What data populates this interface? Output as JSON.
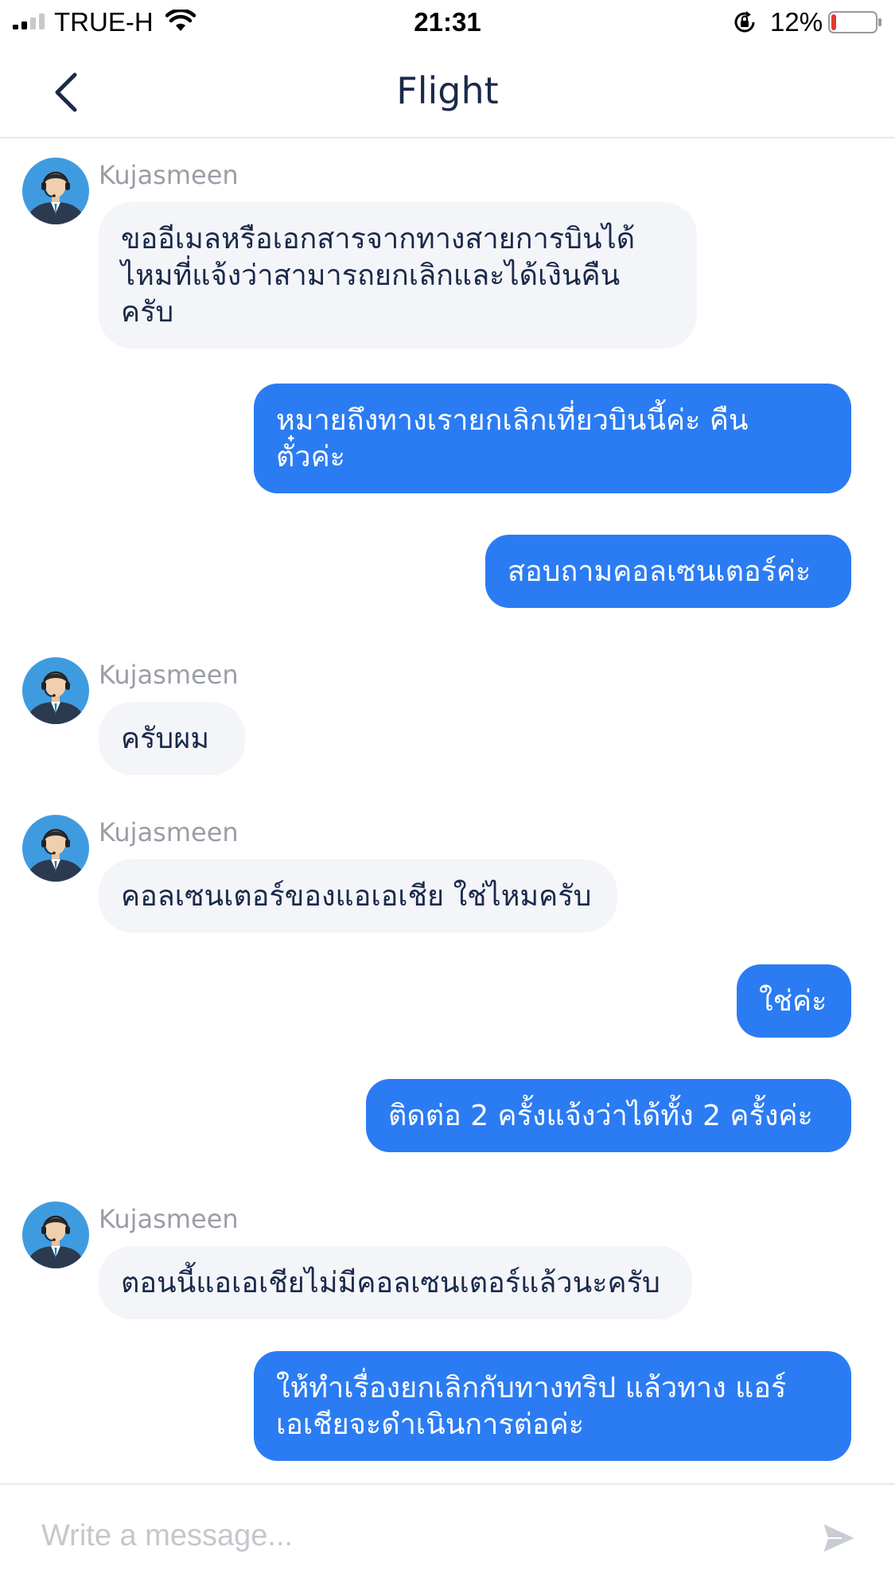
{
  "status_bar": {
    "carrier": "TRUE-H",
    "time": "21:31",
    "battery_percent": "12%",
    "battery_level": 0.12,
    "battery_color": "#e5392f",
    "signal_bars": 2
  },
  "nav": {
    "title": "Flight",
    "back_icon": "chevron-left-icon"
  },
  "chat": {
    "messages": [
      {
        "direction": "incoming",
        "sender": "Kujasmeen",
        "lines": [
          "ขออีเมลหรือเอกสารจากทางสายการบินได้",
          "ไหมที่แจ้งว่าสามารถยกเลิกและได้เงินคืน",
          "ครับ"
        ]
      },
      {
        "direction": "outgoing",
        "lines": [
          "หมายถึงทางเรายกเลิกเที่ยวบินนี้ค่ะ คืน",
          "ตั๋วค่ะ"
        ]
      },
      {
        "direction": "outgoing",
        "lines": [
          "สอบถามคอลเซนเตอร์ค่ะ"
        ]
      },
      {
        "direction": "incoming",
        "sender": "Kujasmeen",
        "lines": [
          "ครับผม"
        ]
      },
      {
        "direction": "incoming",
        "sender": "Kujasmeen",
        "lines": [
          "คอลเซนเตอร์ของแอเอเชีย ใช่ไหมครับ"
        ]
      },
      {
        "direction": "outgoing",
        "lines": [
          "ใช่ค่ะ"
        ]
      },
      {
        "direction": "outgoing",
        "lines": [
          "ติดต่อ 2 ครั้งแจ้งว่าได้ทั้ง 2 ครั้งค่ะ"
        ]
      },
      {
        "direction": "incoming",
        "sender": "Kujasmeen",
        "lines": [
          "ตอนนี้แอเอเชียไม่มีคอลเซนเตอร์แล้วนะครับ"
        ]
      },
      {
        "direction": "outgoing",
        "lines": [
          "ให้ทำเรื่องยกเลิกกับทางทริป แล้วทาง แอร์",
          "เอเชียจะดำเนินการต่อค่ะ"
        ]
      }
    ]
  },
  "composer": {
    "placeholder": "Write a message...",
    "value": "",
    "send_icon": "send-icon"
  },
  "colors": {
    "outgoing_bubble": "#2b7cf3",
    "incoming_bubble": "#f4f5f9",
    "title_text": "#1b2a4a",
    "sender_text": "#9a9ea6"
  }
}
